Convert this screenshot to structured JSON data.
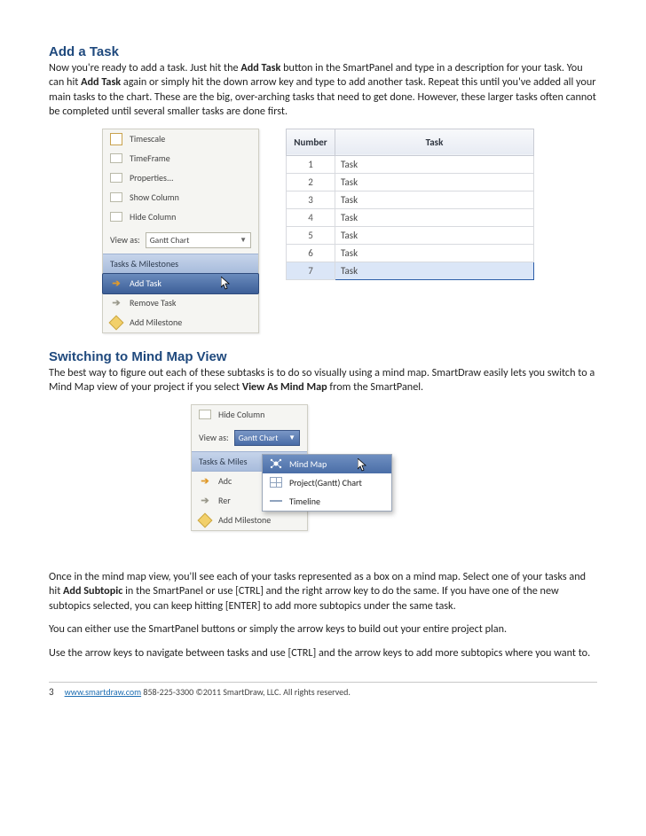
{
  "section1": {
    "heading": "Add a Task",
    "para_a": "Now you're ready to add a task. Just hit the ",
    "para_b_strong": "Add Task",
    "para_c": " button in the SmartPanel and type in a description for your task. You can hit ",
    "para_d_strong": "Add Task",
    "para_e": " again or simply hit the down arrow key and type to add another task. Repeat this until you've added all your main tasks to the chart. These are the big, over-arching tasks that need to get done. However, these larger tasks often cannot be completed until several smaller tasks are done first."
  },
  "panel1": {
    "items": [
      {
        "label": "Timescale"
      },
      {
        "label": "TimeFrame"
      },
      {
        "label": "Properties..."
      },
      {
        "label": "Show Column"
      },
      {
        "label": "Hide Column"
      }
    ],
    "view_as_label": "View as:",
    "view_as_value": "Gantt Chart",
    "band": "Tasks & Milestones",
    "actions": [
      {
        "label": "Add Task",
        "state": "hover"
      },
      {
        "label": "Remove Task"
      },
      {
        "label": "Add Milestone"
      }
    ]
  },
  "table": {
    "col_number": "Number",
    "col_task": "Task",
    "rows": [
      {
        "n": "1",
        "t": "Task"
      },
      {
        "n": "2",
        "t": "Task"
      },
      {
        "n": "3",
        "t": "Task"
      },
      {
        "n": "4",
        "t": "Task"
      },
      {
        "n": "5",
        "t": "Task"
      },
      {
        "n": "6",
        "t": "Task"
      },
      {
        "n": "7",
        "t": "Task"
      }
    ]
  },
  "section2": {
    "heading": "Switching to Mind Map View",
    "para_a": "The best way to figure out each of these subtasks is to do so visually using a mind map. SmartDraw easily lets you switch to a Mind Map view of your project if you select ",
    "para_b_strong": "View As Mind Map",
    "para_c": " from the SmartPanel."
  },
  "panel2": {
    "hide_col": "Hide Column",
    "view_as_label": "View as:",
    "view_as_value": "Gantt Chart",
    "band": "Tasks & Miles",
    "actions_short": [
      "Adc",
      "Rer",
      "Add Milestone"
    ],
    "menu": [
      {
        "label": "Mind Map",
        "sel": true
      },
      {
        "label": "Project(Gantt) Chart"
      },
      {
        "label": "Timeline"
      }
    ]
  },
  "postparas": {
    "p1a": "Once in the mind map view, you'll see each of your tasks represented as a box on a mind map. Select one of your tasks and hit ",
    "p1b_strong": "Add Subtopic",
    "p1c": " in the SmartPanel or use [CTRL] and the right arrow key to do the same.  If you have one of the new subtopics selected, you can keep hitting [ENTER] to add more subtopics under the same task.",
    "p2": "You can either use the SmartPanel buttons or simply the arrow keys to build out your entire project plan.",
    "p3": "Use the arrow keys to navigate between tasks and use [CTRL] and the arrow keys to add more subtopics where you want to."
  },
  "footer": {
    "page": "3",
    "url": "www.smartdraw.com",
    "rest": " 858-225-3300 ©2011 SmartDraw, LLC. All rights reserved."
  }
}
